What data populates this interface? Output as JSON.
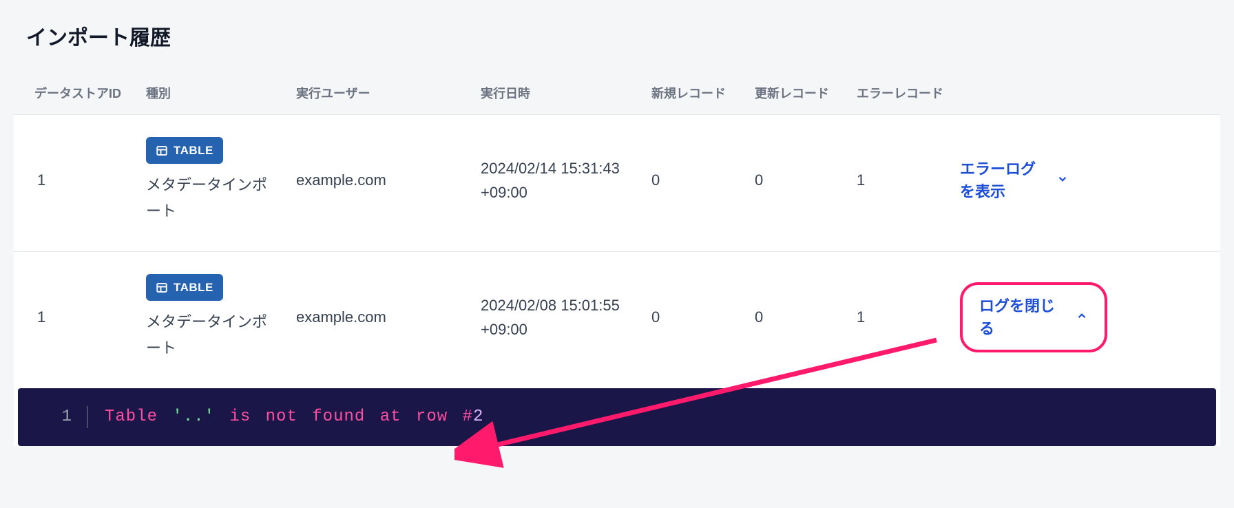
{
  "page": {
    "title": "インポート履歴"
  },
  "headers": {
    "id": "データストアID",
    "type": "種別",
    "user": "実行ユーザー",
    "date": "実行日時",
    "new": "新規レコード",
    "upd": "更新レコード",
    "err": "エラーレコード"
  },
  "badge": {
    "label": "TABLE"
  },
  "rows": [
    {
      "id": "1",
      "type_label": "メタデータインポート",
      "user": "example.com",
      "date": "2024/02/14 15:31:43 +09:00",
      "new": "0",
      "upd": "0",
      "err": "1",
      "action": "エラーログを表示",
      "expanded": false
    },
    {
      "id": "1",
      "type_label": "メタデータインポート",
      "user": "example.com",
      "date": "2024/02/08 15:01:55 +09:00",
      "new": "0",
      "upd": "0",
      "err": "1",
      "action": "ログを閉じる",
      "expanded": true
    }
  ],
  "log": {
    "lineno": "1",
    "tokens": {
      "kw1": "Table",
      "str": "'..'",
      "kw2": "is",
      "kw3": "not",
      "kw4": "found",
      "kw5": "at",
      "kw6": "row",
      "op": "#",
      "num": "2"
    }
  }
}
